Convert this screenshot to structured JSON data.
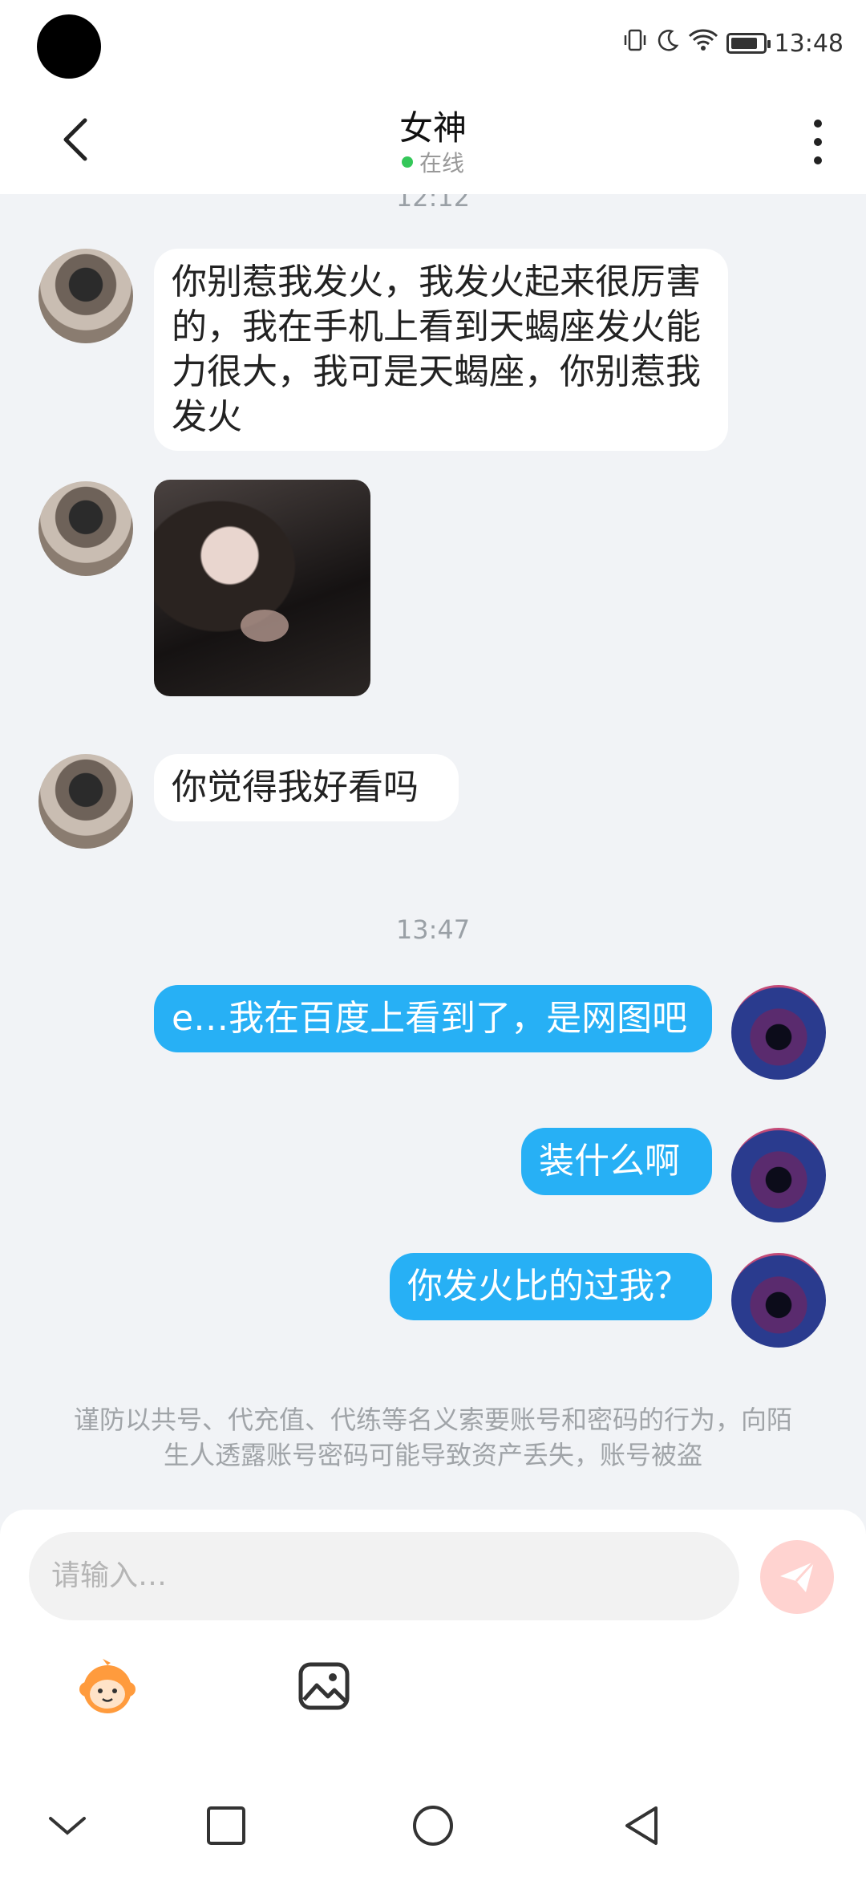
{
  "status_bar": {
    "time": "13:48"
  },
  "header": {
    "title": "女神",
    "status": "在线"
  },
  "timestamps": [
    "12:12",
    "13:47"
  ],
  "messages": {
    "m1": "你别惹我发火，我发火起来很厉害的，我在手机上看到天蝎座发火能力很大，我可是天蝎座，你别惹我发火",
    "m3": "你觉得我好看吗",
    "m4": "e…我在百度上看到了，是网图吧",
    "m5": "装什么啊",
    "m6": "你发火比的过我？"
  },
  "notice": "谨防以共号、代充值、代练等名义索要账号和密码的行为，向陌生人透露账号密码可能导致资产丢失，账号被盗",
  "input": {
    "placeholder": "请输入…"
  },
  "colors": {
    "outgoing_bubble": "#27b0f5",
    "incoming_bubble": "#ffffff",
    "background": "#f1f3f6",
    "send_button": "#ffd3d0"
  }
}
